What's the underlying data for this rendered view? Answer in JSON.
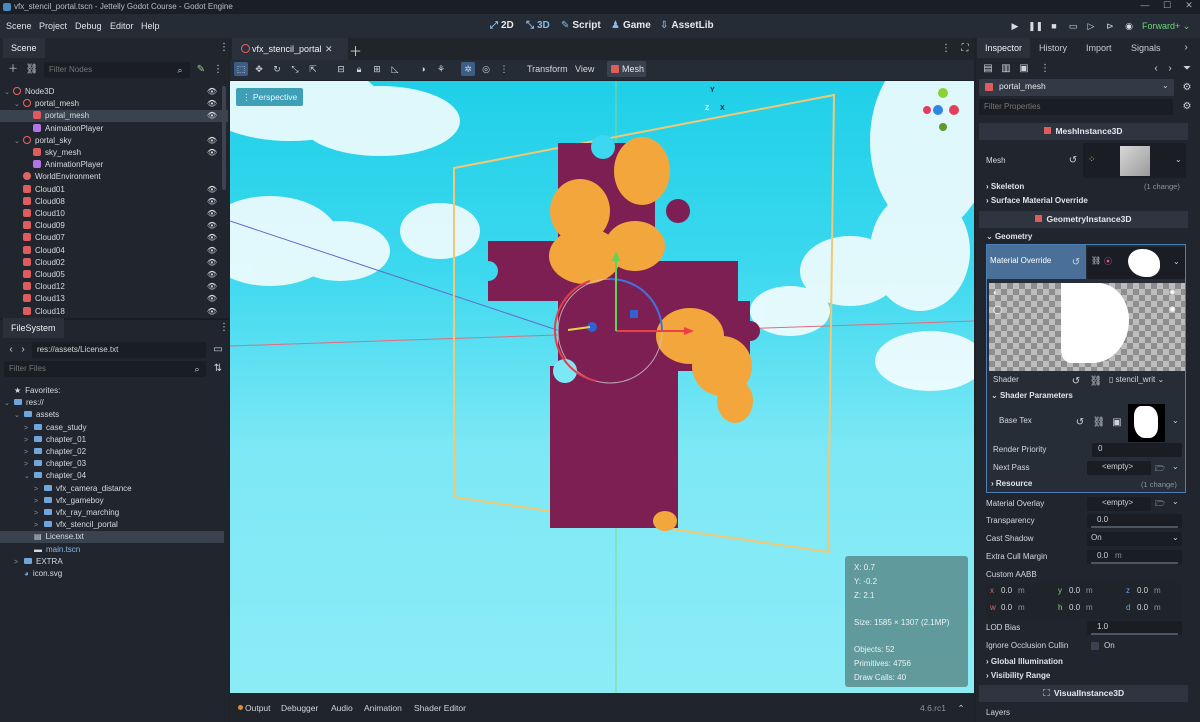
{
  "window": {
    "title": "vfx_stencil_portal.tscn - Jettelly Godot Course - Godot Engine"
  },
  "menu": {
    "items": [
      "Scene",
      "Project",
      "Debug",
      "Editor",
      "Help"
    ]
  },
  "main_screens": {
    "d2": "2D",
    "d3": "3D",
    "script": "Script",
    "game": "Game",
    "assetlib": "AssetLib"
  },
  "renderer": "Forward+",
  "scene_panel": {
    "tab": "Scene",
    "filter_placeholder": "Filter Nodes",
    "nodes": [
      {
        "name": "Node3D",
        "indent": 0,
        "arrow": "⌄",
        "kind": "node3d",
        "eye": true
      },
      {
        "name": "portal_mesh",
        "indent": 1,
        "arrow": "⌄",
        "kind": "node3d",
        "eye": true
      },
      {
        "name": "portal_mesh",
        "indent": 2,
        "arrow": "",
        "kind": "mesh",
        "eye": true,
        "selected": true
      },
      {
        "name": "AnimationPlayer",
        "indent": 2,
        "arrow": "",
        "kind": "anim",
        "eye": false
      },
      {
        "name": "portal_sky",
        "indent": 1,
        "arrow": "⌄",
        "kind": "node3d",
        "eye": true
      },
      {
        "name": "sky_mesh",
        "indent": 2,
        "arrow": "",
        "kind": "mesh",
        "eye": true
      },
      {
        "name": "AnimationPlayer",
        "indent": 2,
        "arrow": "",
        "kind": "anim",
        "eye": false
      },
      {
        "name": "WorldEnvironment",
        "indent": 1,
        "arrow": "",
        "kind": "world",
        "eye": false
      },
      {
        "name": "Cloud01",
        "indent": 1,
        "arrow": "",
        "kind": "mesh",
        "eye": true
      },
      {
        "name": "Cloud08",
        "indent": 1,
        "arrow": "",
        "kind": "mesh",
        "eye": true
      },
      {
        "name": "Cloud10",
        "indent": 1,
        "arrow": "",
        "kind": "mesh",
        "eye": true
      },
      {
        "name": "Cloud09",
        "indent": 1,
        "arrow": "",
        "kind": "mesh",
        "eye": true
      },
      {
        "name": "Cloud07",
        "indent": 1,
        "arrow": "",
        "kind": "mesh",
        "eye": true
      },
      {
        "name": "Cloud04",
        "indent": 1,
        "arrow": "",
        "kind": "mesh",
        "eye": true
      },
      {
        "name": "Cloud02",
        "indent": 1,
        "arrow": "",
        "kind": "mesh",
        "eye": true
      },
      {
        "name": "Cloud05",
        "indent": 1,
        "arrow": "",
        "kind": "mesh",
        "eye": true
      },
      {
        "name": "Cloud12",
        "indent": 1,
        "arrow": "",
        "kind": "mesh",
        "eye": true
      },
      {
        "name": "Cloud13",
        "indent": 1,
        "arrow": "",
        "kind": "mesh",
        "eye": true
      },
      {
        "name": "Cloud18",
        "indent": 1,
        "arrow": "",
        "kind": "mesh",
        "eye": true
      }
    ]
  },
  "filesystem": {
    "tab": "FileSystem",
    "path": "res://assets/License.txt",
    "filter_placeholder": "Filter Files",
    "items": [
      {
        "name": "Favorites:",
        "indent": 0,
        "arrow": "",
        "kind": "star"
      },
      {
        "name": "res://",
        "indent": 0,
        "arrow": "⌄",
        "kind": "folder"
      },
      {
        "name": "assets",
        "indent": 1,
        "arrow": "⌄",
        "kind": "folder"
      },
      {
        "name": "case_study",
        "indent": 2,
        "arrow": ">",
        "kind": "folder"
      },
      {
        "name": "chapter_01",
        "indent": 2,
        "arrow": ">",
        "kind": "folder"
      },
      {
        "name": "chapter_02",
        "indent": 2,
        "arrow": ">",
        "kind": "folder"
      },
      {
        "name": "chapter_03",
        "indent": 2,
        "arrow": ">",
        "kind": "folder"
      },
      {
        "name": "chapter_04",
        "indent": 2,
        "arrow": "⌄",
        "kind": "folder"
      },
      {
        "name": "vfx_camera_distance",
        "indent": 3,
        "arrow": ">",
        "kind": "folder"
      },
      {
        "name": "vfx_gameboy",
        "indent": 3,
        "arrow": ">",
        "kind": "folder"
      },
      {
        "name": "vfx_ray_marching",
        "indent": 3,
        "arrow": ">",
        "kind": "folder"
      },
      {
        "name": "vfx_stencil_portal",
        "indent": 3,
        "arrow": ">",
        "kind": "folder"
      },
      {
        "name": "License.txt",
        "indent": 2,
        "arrow": "",
        "kind": "text",
        "selected": true
      },
      {
        "name": "main.tscn",
        "indent": 2,
        "arrow": "",
        "kind": "scene",
        "blue": true
      },
      {
        "name": "EXTRA",
        "indent": 1,
        "arrow": ">",
        "kind": "folder"
      },
      {
        "name": "icon.svg",
        "indent": 1,
        "arrow": "",
        "kind": "svg"
      }
    ]
  },
  "editor_tab": {
    "name": "vfx_stencil_portal"
  },
  "viewport_toolbar": {
    "transform": "Transform",
    "view": "View",
    "mesh": "Mesh"
  },
  "viewport": {
    "perspective": "Perspective",
    "gizmo": {
      "y": "Y",
      "z": "Z",
      "x": "X"
    },
    "stats": {
      "x": "X: 0.7",
      "y": "Y: -0.2",
      "z": "Z: 2.1",
      "size": "Size: 1585 × 1307 (2.1MP)",
      "objects": "Objects: 52",
      "primitives": "Primitives: 4756",
      "draw_calls": "Draw Calls: 40"
    }
  },
  "bottom_panel": {
    "tabs": [
      "Output",
      "Debugger",
      "Audio",
      "Animation",
      "Shader Editor"
    ],
    "version": "4.6.rc1"
  },
  "inspector": {
    "tabs": [
      "Inspector",
      "History",
      "Import",
      "Signals"
    ],
    "object_name": "portal_mesh",
    "filter_placeholder": "Filter Properties",
    "mesh_instance_section": "MeshInstance3D",
    "mesh_label": "Mesh",
    "skeleton": "Skeleton",
    "skeleton_change": "(1 change)",
    "surface_override": "Surface Material Override",
    "geometry_section": "GeometryInstance3D",
    "geometry": "Geometry",
    "material_override": "Material Override",
    "shader_label": "Shader",
    "shader_value": "stencil_writ",
    "shader_params": "Shader Parameters",
    "base_tex": "Base Tex",
    "render_priority_label": "Render Priority",
    "render_priority_value": "0",
    "next_pass_label": "Next Pass",
    "next_pass_value": "<empty>",
    "resource": "Resource",
    "resource_change": "(1 change)",
    "material_overlay_label": "Material Overlay",
    "material_overlay_value": "<empty>",
    "transparency_label": "Transparency",
    "transparency_value": "0.0",
    "cast_shadow_label": "Cast Shadow",
    "cast_shadow_value": "On",
    "extra_cull_label": "Extra Cull Margin",
    "extra_cull_value": "0.0",
    "extra_cull_unit": "m",
    "custom_aabb": "Custom AABB",
    "aabb": {
      "x": "0.0",
      "y": "0.0",
      "z": "0.0",
      "w": "0.0",
      "h": "0.0",
      "d": "0.0",
      "xl": "x",
      "yl": "y",
      "zl": "z",
      "wl": "w",
      "hl": "h",
      "dl": "d",
      "unit": "m"
    },
    "lod_bias_label": "LOD Bias",
    "lod_bias_value": "1.0",
    "ignore_occlusion_label": "Ignore Occlusion Cullin",
    "ignore_occlusion_value": "On",
    "global_illumination": "Global Illumination",
    "visibility_range": "Visibility Range",
    "visual_instance_section": "VisualInstance3D",
    "layers": "Layers"
  }
}
